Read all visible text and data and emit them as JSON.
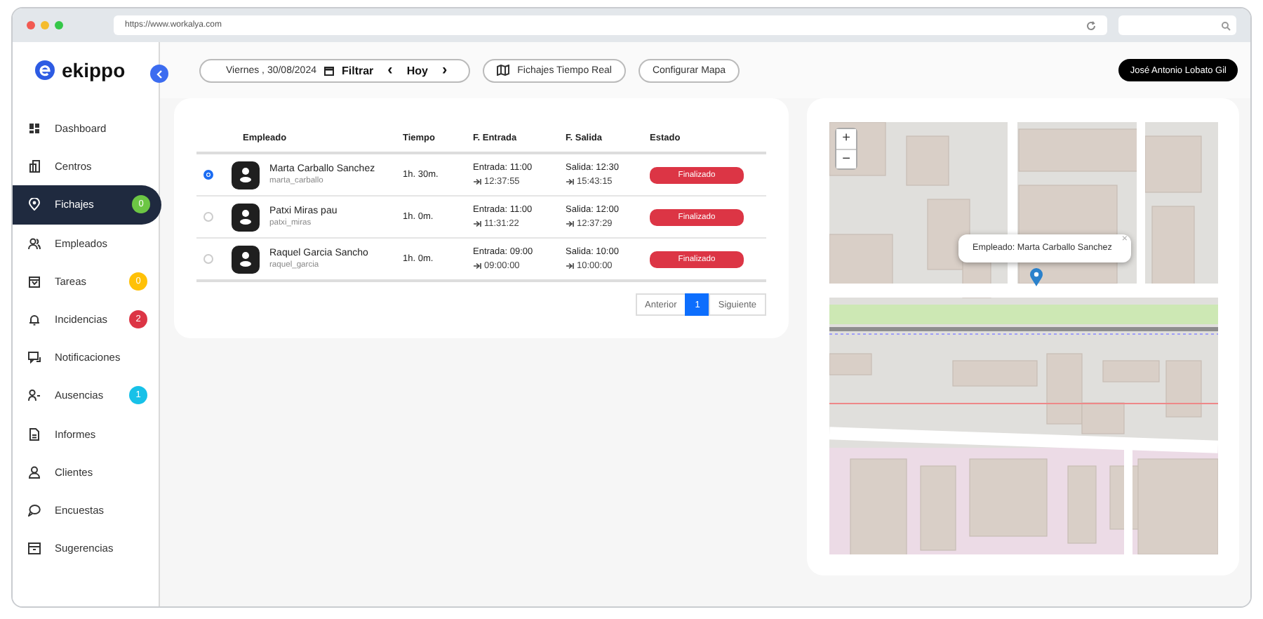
{
  "browser": {
    "url": "https://www.workalya.com"
  },
  "brand": {
    "name": "ekippo"
  },
  "toolbar": {
    "date": "Viernes , 30/08/2024",
    "filter": "Filtrar",
    "prev": "‹",
    "today": "Hoy",
    "next": "›",
    "realtime": "Fichajes Tiempo Real",
    "configure": "Configurar Mapa",
    "user": "José Antonio Lobato Gil"
  },
  "sidebar": {
    "items": [
      {
        "label": "Dashboard",
        "selected": false
      },
      {
        "label": "Centros",
        "selected": false
      },
      {
        "label": "Fichajes",
        "selected": true,
        "badge": "0",
        "color": "#6cc644"
      },
      {
        "label": "Empleados",
        "selected": false
      },
      {
        "label": "Tareas",
        "selected": false,
        "badge": "0",
        "color": "#ffc107"
      },
      {
        "label": "Incidencias",
        "selected": false,
        "badge": "2",
        "color": "#dc3545"
      },
      {
        "label": "Notificaciones",
        "selected": false
      },
      {
        "label": "Ausencias",
        "selected": false,
        "badge": "1",
        "color": "#17c1e8"
      },
      {
        "label": "Informes",
        "selected": false
      },
      {
        "label": "Clientes",
        "selected": false
      },
      {
        "label": "Encuestas",
        "selected": false
      },
      {
        "label": "Sugerencias",
        "selected": false
      }
    ]
  },
  "table": {
    "columns": [
      "Empleado",
      "Tiempo",
      "F. Entrada",
      "F. Salida",
      "Estado"
    ],
    "rows": [
      {
        "selected": true,
        "name": "Marta Carballo Sanchez",
        "username": "marta_carballo",
        "time": "1h. 30m.",
        "entry": "Entrada: 11:00",
        "entry_actual": "12:37:55",
        "exit": "Salida: 12:30",
        "exit_actual": "15:43:15",
        "status": "Finalizado"
      },
      {
        "selected": false,
        "name": "Patxi Miras pau",
        "username": "patxi_miras",
        "time": "1h. 0m.",
        "entry": "Entrada: 11:00",
        "entry_actual": "11:31:22",
        "exit": "Salida: 12:00",
        "exit_actual": "12:37:29",
        "status": "Finalizado"
      },
      {
        "selected": false,
        "name": "Raquel Garcia Sancho",
        "username": "raquel_garcia",
        "time": "1h. 0m.",
        "entry": "Entrada: 09:00",
        "entry_actual": "09:00:00",
        "exit": "Salida: 10:00",
        "exit_actual": "10:00:00",
        "status": "Finalizado"
      }
    ]
  },
  "pagination": {
    "prev": "Anterior",
    "pages": [
      {
        "label": "1",
        "selected": true
      }
    ],
    "next": "Siguiente"
  },
  "map": {
    "zoom_in": "+",
    "zoom_out": "−",
    "popup": "Empleado: Marta Carballo Sanchez",
    "close": "×"
  }
}
